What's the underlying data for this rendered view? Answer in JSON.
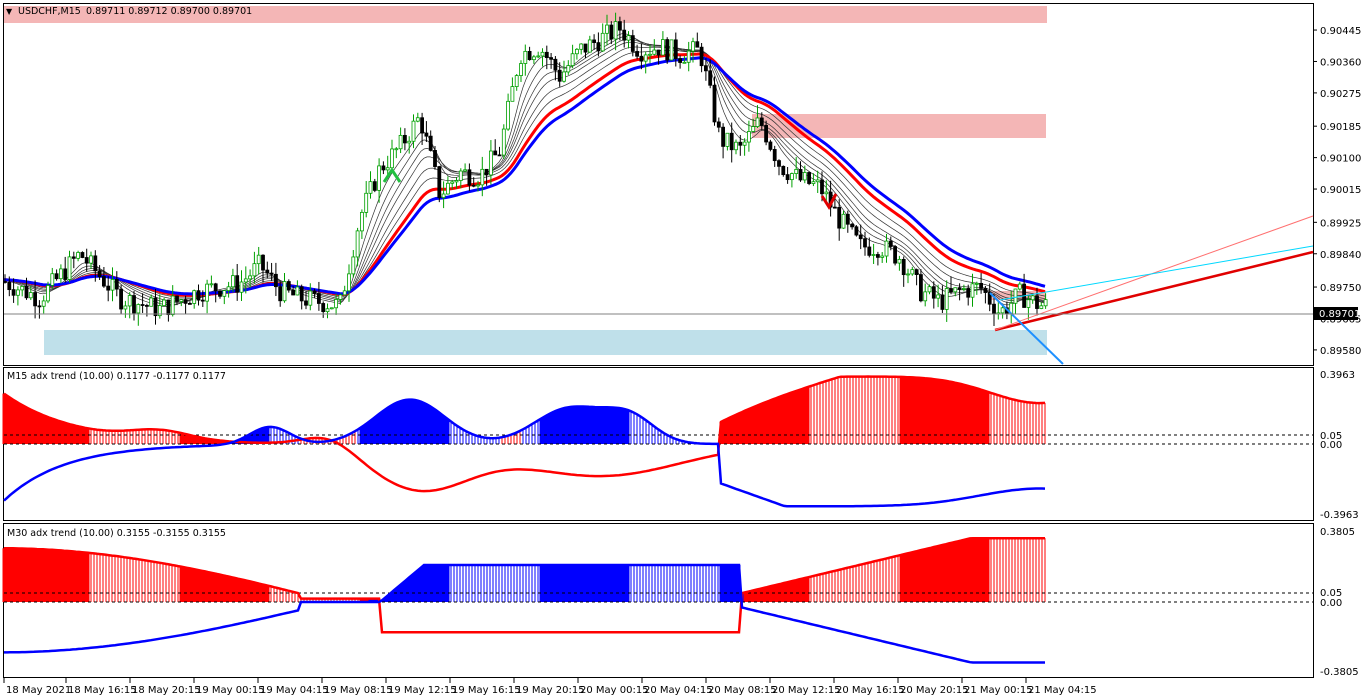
{
  "main_panel": {
    "symbol_label": "USDCHF,M15",
    "ohlc_label": "0.89711 0.89712 0.89700 0.89701",
    "current_price_label": "0.89701",
    "y_ticks": [
      "0.90445",
      "0.90360",
      "0.90275",
      "0.90185",
      "0.90100",
      "0.90015",
      "0.89925",
      "0.89840",
      "0.89750",
      "0.89665",
      "0.89580"
    ],
    "ylim": [
      0.8955,
      0.9051
    ],
    "colors": {
      "ma_red": "#ff0000",
      "ma_blue": "#0000ff",
      "ma_gray": "#333333",
      "bull": "#00a000",
      "bear": "#000000",
      "supply_zone": "#f4b6b6",
      "demand_zone": "#bfe0ea",
      "trend_red": "#e00000",
      "trend_cyan": "#00d8ff",
      "trend_blue": "#1e90ff"
    }
  },
  "adx_m15": {
    "title": "M15 adx trend (10.00) 0.1177 -0.1177 0.1177",
    "ticks": [
      "0.3963",
      "0.05",
      "0.00",
      "-0.3963"
    ]
  },
  "adx_m30": {
    "title": "M30 adx trend (10.00) 0.3155 -0.3155 0.3155",
    "ticks": [
      "0.3805",
      "0.05",
      "0.00",
      "-0.3805"
    ]
  },
  "time_axis": {
    "labels": [
      "18 May 2021",
      "18 May 16:15",
      "18 May 20:15",
      "19 May 00:15",
      "19 May 04:15",
      "19 May 08:15",
      "19 May 12:15",
      "19 May 16:15",
      "19 May 20:15",
      "20 May 00:15",
      "20 May 04:15",
      "20 May 08:15",
      "20 May 12:15",
      "20 May 16:15",
      "20 May 20:15",
      "21 May 00:15",
      "21 May 04:15"
    ]
  },
  "chart_data": {
    "type": "line",
    "series": [
      {
        "name": "USDCHF,M15",
        "x": [
          0,
          40,
          80,
          120,
          160,
          200,
          240,
          260,
          280,
          300,
          320,
          340,
          360,
          380,
          400,
          420,
          440,
          460,
          480,
          500,
          520,
          540,
          560,
          580,
          600,
          620,
          640,
          660,
          680,
          700,
          720,
          740,
          760,
          780,
          800,
          820,
          840,
          860,
          880,
          900,
          920,
          940,
          960,
          980,
          1000,
          1020,
          1040
        ],
        "values": [
          0.8977,
          0.8972,
          0.8984,
          0.8972,
          0.8969,
          0.8974,
          0.8976,
          0.8981,
          0.8974,
          0.8972,
          0.8971,
          0.897,
          0.8994,
          0.9007,
          0.9013,
          0.9021,
          0.9,
          0.9006,
          0.9005,
          0.9012,
          0.9038,
          0.904,
          0.9032,
          0.9039,
          0.9042,
          0.9045,
          0.9039,
          0.904,
          0.9038,
          0.9039,
          0.9015,
          0.9012,
          0.902,
          0.9008,
          0.9004,
          0.9002,
          0.8993,
          0.8986,
          0.8986,
          0.8983,
          0.8974,
          0.8971,
          0.8974,
          0.8975,
          0.8968,
          0.8973,
          0.897
        ]
      }
    ]
  }
}
